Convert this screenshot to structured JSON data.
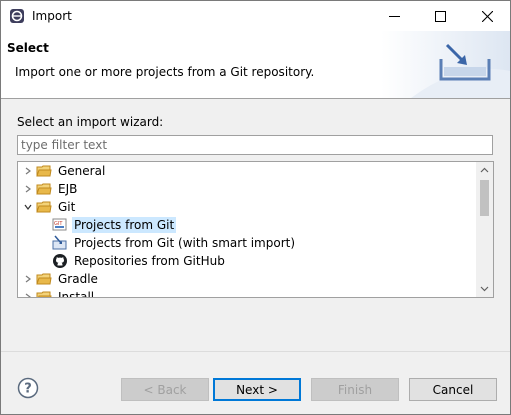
{
  "window": {
    "title": "Import"
  },
  "header": {
    "title": "Select",
    "description": "Import one or more projects from a Git repository."
  },
  "wizard": {
    "select_label": "Select an import wizard:",
    "filter_placeholder": "type filter text",
    "tree": [
      {
        "label": "General",
        "icon": "folder-icon",
        "expanded": false,
        "level": 0
      },
      {
        "label": "EJB",
        "icon": "folder-icon",
        "expanded": false,
        "level": 0
      },
      {
        "label": "Git",
        "icon": "folder-icon",
        "expanded": true,
        "level": 0
      },
      {
        "label": "Projects from Git",
        "icon": "git-projects-icon",
        "level": 1,
        "selected": true
      },
      {
        "label": "Projects from Git (with smart import)",
        "icon": "git-smart-import-icon",
        "level": 1
      },
      {
        "label": "Repositories from GitHub",
        "icon": "github-icon",
        "level": 1
      },
      {
        "label": "Gradle",
        "icon": "folder-icon",
        "expanded": false,
        "level": 0
      },
      {
        "label": "Install",
        "icon": "folder-icon",
        "expanded": false,
        "level": 0
      }
    ]
  },
  "buttons": {
    "back": "< Back",
    "next": "Next >",
    "finish": "Finish",
    "cancel": "Cancel"
  },
  "colors": {
    "selection": "#cce8ff",
    "default_button_border": "#0078d7",
    "folder": "#e8b84a"
  }
}
